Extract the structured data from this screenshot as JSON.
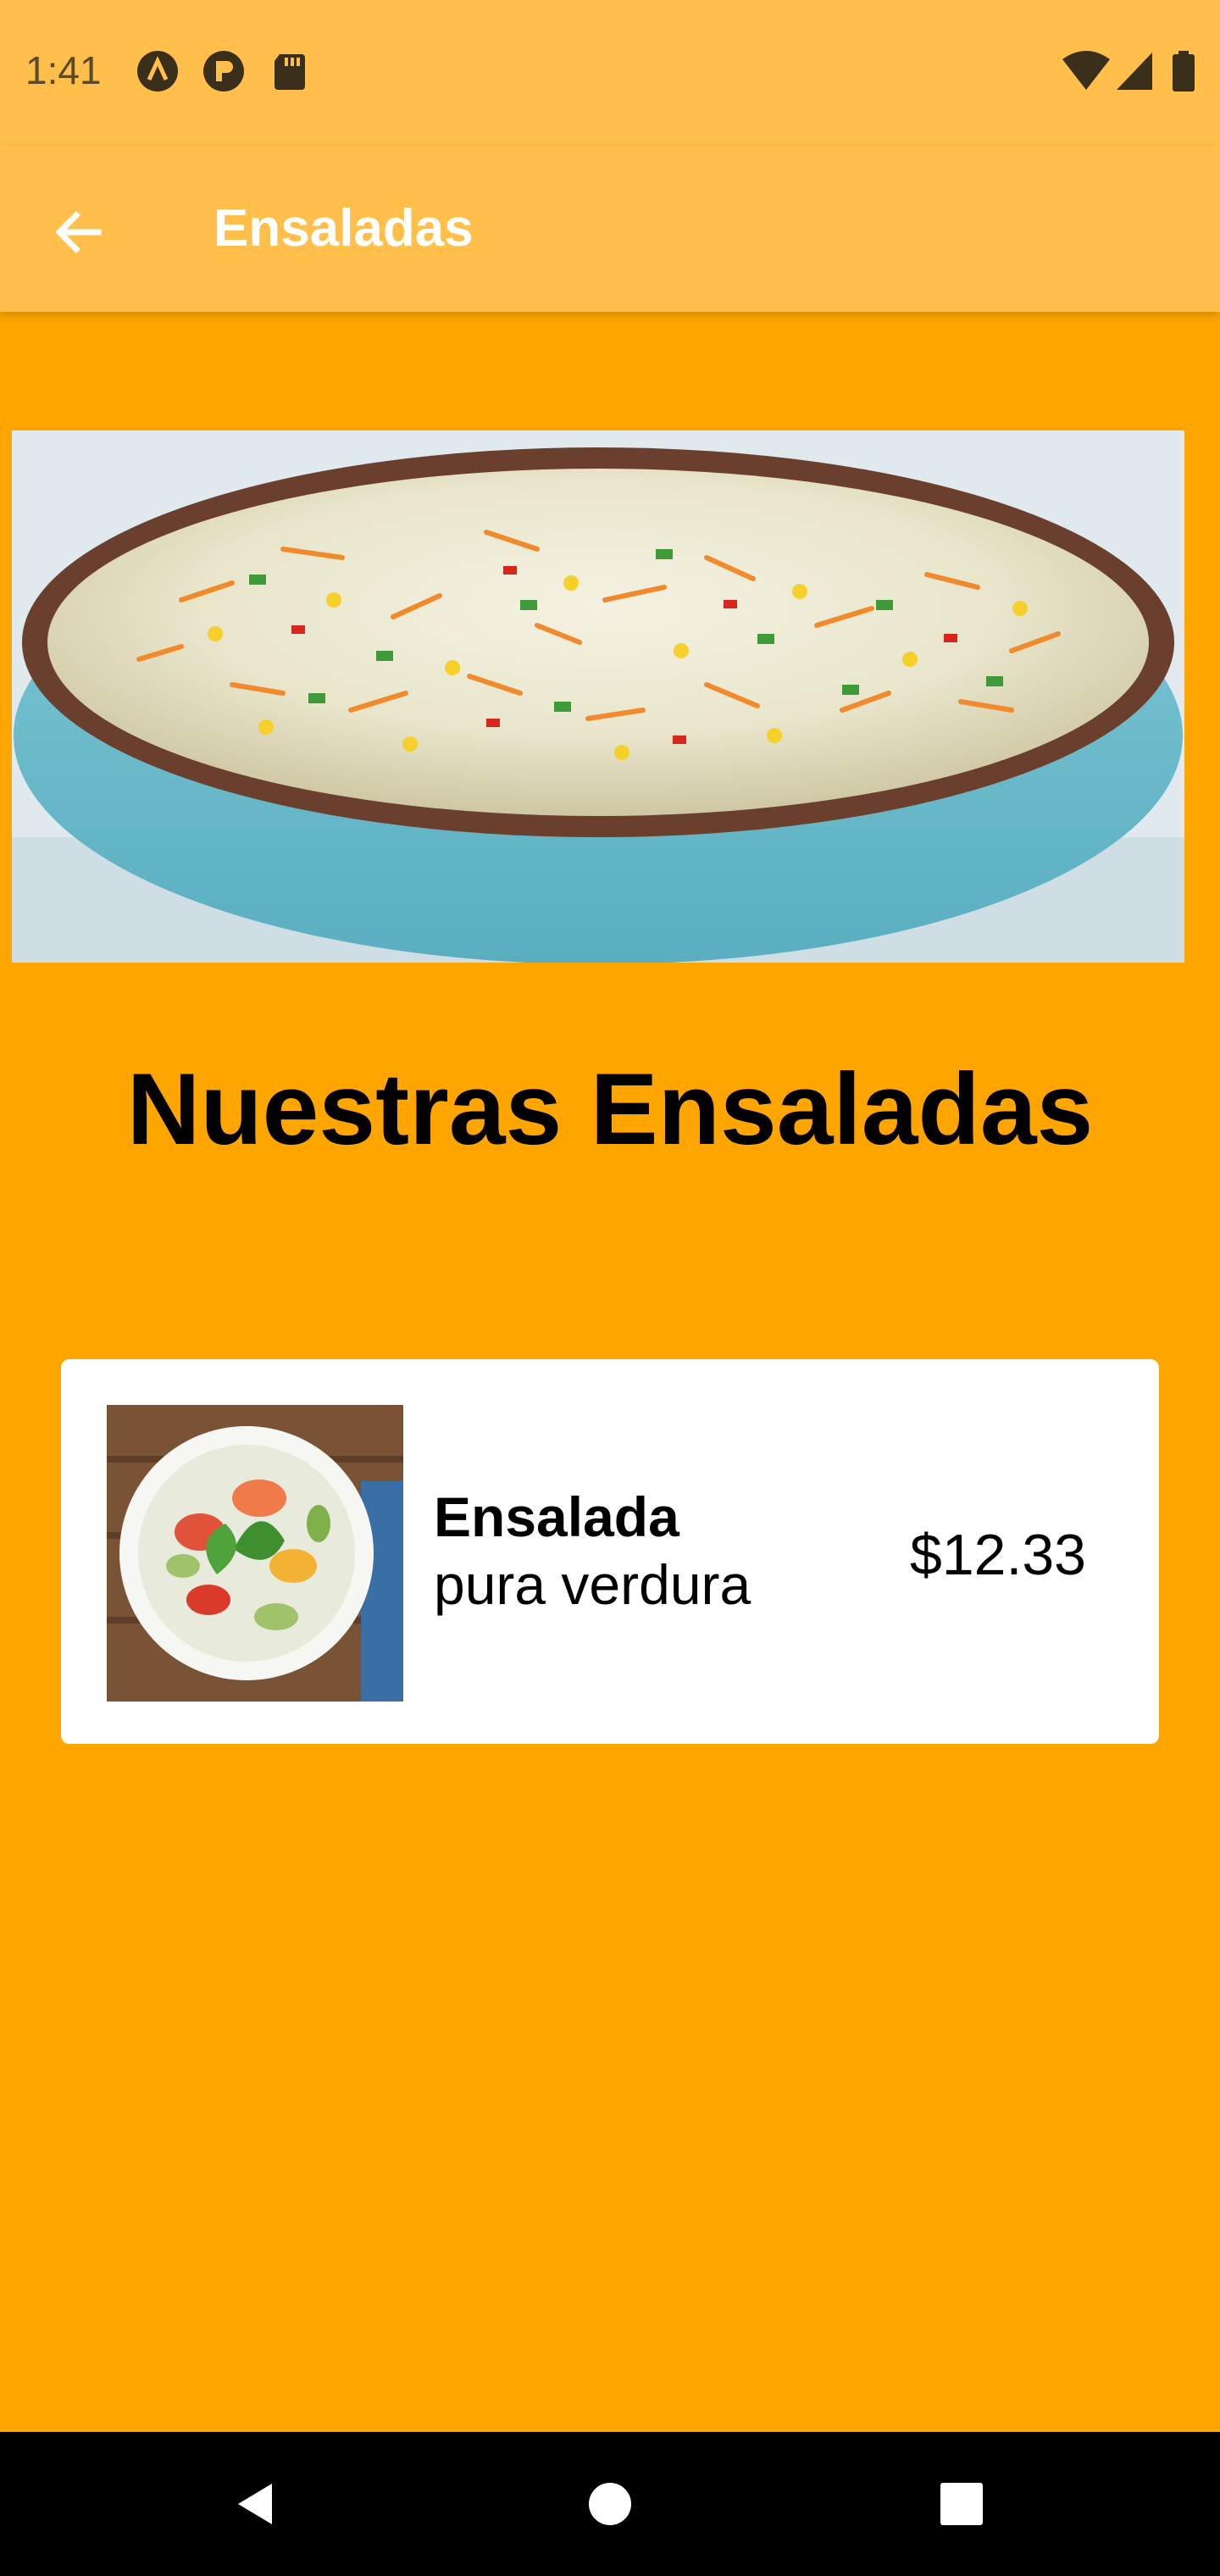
{
  "status_bar": {
    "time": "1:41",
    "icons": [
      "a11y-icon",
      "p-app-icon",
      "sd-card-icon",
      "wifi-icon",
      "cell-signal-icon",
      "battery-icon"
    ]
  },
  "app_bar": {
    "title": "Ensaladas",
    "back_icon": "arrow-left-icon"
  },
  "hero": {
    "alt": "Ensalada de repollo, zanahoria y maíz"
  },
  "section": {
    "title": "Nuestras Ensaladas"
  },
  "products": [
    {
      "name": "Ensalada",
      "description": "pura verdura",
      "price": "$12.33"
    }
  ],
  "nav": {
    "back": "nav-back-icon",
    "home": "nav-home-icon",
    "recents": "nav-recents-icon"
  },
  "colors": {
    "background": "#FFA500",
    "app_bar": "#FFBF4A",
    "card": "#FFFFFF"
  }
}
